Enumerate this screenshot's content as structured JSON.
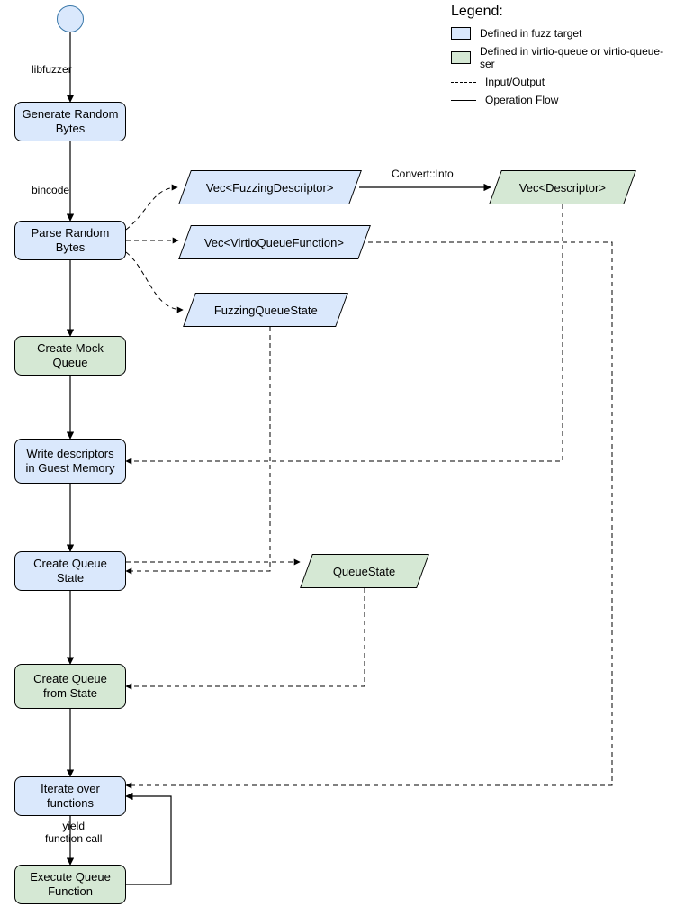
{
  "legend": {
    "title": "Legend:",
    "fuzz_target": "Defined in fuzz target",
    "virtio": "Defined in virtio-queue or virtio-queue-ser",
    "io": "Input/Output",
    "opflow": "Operation Flow"
  },
  "nodes": {
    "gen_bytes": "Generate Random Bytes",
    "parse_bytes": "Parse Random Bytes",
    "create_mock_queue": "Create Mock Queue",
    "write_desc": "Write descriptors in Guest Memory",
    "create_queue_state": "Create Queue State",
    "create_queue_from_state": "Create Queue from State",
    "iterate": "Iterate over functions",
    "exec": "Execute Queue Function"
  },
  "datatypes": {
    "vec_fuzz_desc": "Vec<FuzzingDescriptor>",
    "vec_virtio_fn": "Vec<VirtioQueueFunction>",
    "fuzz_q_state": "FuzzingQueueState",
    "vec_desc": "Vec<Descriptor>",
    "queue_state": "QueueState"
  },
  "labels": {
    "libfuzzer": "libfuzzer",
    "bincode": "bincode",
    "convert_into": "Convert::Into",
    "yield_fn": "yield\nfunction call"
  },
  "chart_data": {
    "type": "flowchart",
    "title": "",
    "start": "start-node",
    "legend": {
      "blue": "Defined in fuzz target",
      "green": "Defined in virtio-queue or virtio-queue-ser",
      "dashed_line": "Input/Output",
      "solid_line": "Operation Flow"
    },
    "nodes": [
      {
        "id": "start-node",
        "shape": "circle",
        "color": "blue",
        "label": ""
      },
      {
        "id": "gen-bytes",
        "shape": "rounded-rect",
        "color": "blue",
        "label": "Generate Random Bytes"
      },
      {
        "id": "parse-bytes",
        "shape": "rounded-rect",
        "color": "blue",
        "label": "Parse Random Bytes"
      },
      {
        "id": "create-mock-queue",
        "shape": "rounded-rect",
        "color": "green",
        "label": "Create Mock Queue"
      },
      {
        "id": "write-desc",
        "shape": "rounded-rect",
        "color": "blue",
        "label": "Write descriptors in Guest Memory"
      },
      {
        "id": "create-queue-state",
        "shape": "rounded-rect",
        "color": "blue",
        "label": "Create Queue State"
      },
      {
        "id": "create-queue-from-state",
        "shape": "rounded-rect",
        "color": "green",
        "label": "Create Queue from State"
      },
      {
        "id": "iterate",
        "shape": "rounded-rect",
        "color": "blue",
        "label": "Iterate over functions"
      },
      {
        "id": "exec",
        "shape": "rounded-rect",
        "color": "green",
        "label": "Execute Queue Function"
      },
      {
        "id": "vec-fuzz-desc",
        "shape": "parallelogram",
        "color": "blue",
        "label": "Vec<FuzzingDescriptor>"
      },
      {
        "id": "vec-virtio-fn",
        "shape": "parallelogram",
        "color": "blue",
        "label": "Vec<VirtioQueueFunction>"
      },
      {
        "id": "fuzz-q-state",
        "shape": "parallelogram",
        "color": "blue",
        "label": "FuzzingQueueState"
      },
      {
        "id": "vec-desc",
        "shape": "parallelogram",
        "color": "green",
        "label": "Vec<Descriptor>"
      },
      {
        "id": "queue-state",
        "shape": "parallelogram",
        "color": "green",
        "label": "QueueState"
      }
    ],
    "edges": [
      {
        "from": "start-node",
        "to": "gen-bytes",
        "style": "solid",
        "label": "libfuzzer"
      },
      {
        "from": "gen-bytes",
        "to": "parse-bytes",
        "style": "solid",
        "label": "bincode"
      },
      {
        "from": "parse-bytes",
        "to": "create-mock-queue",
        "style": "solid",
        "label": ""
      },
      {
        "from": "create-mock-queue",
        "to": "write-desc",
        "style": "solid",
        "label": ""
      },
      {
        "from": "write-desc",
        "to": "create-queue-state",
        "style": "solid",
        "label": ""
      },
      {
        "from": "create-queue-state",
        "to": "create-queue-from-state",
        "style": "solid",
        "label": ""
      },
      {
        "from": "create-queue-from-state",
        "to": "iterate",
        "style": "solid",
        "label": ""
      },
      {
        "from": "iterate",
        "to": "exec",
        "style": "solid",
        "label": "yield function call"
      },
      {
        "from": "exec",
        "to": "iterate",
        "style": "solid",
        "label": ""
      },
      {
        "from": "parse-bytes",
        "to": "vec-fuzz-desc",
        "style": "dashed",
        "label": ""
      },
      {
        "from": "parse-bytes",
        "to": "vec-virtio-fn",
        "style": "dashed",
        "label": ""
      },
      {
        "from": "parse-bytes",
        "to": "fuzz-q-state",
        "style": "dashed",
        "label": ""
      },
      {
        "from": "vec-fuzz-desc",
        "to": "vec-desc",
        "style": "solid",
        "label": "Convert::Into"
      },
      {
        "from": "vec-desc",
        "to": "write-desc",
        "style": "dashed",
        "label": ""
      },
      {
        "from": "fuzz-q-state",
        "to": "create-queue-state",
        "style": "dashed",
        "label": ""
      },
      {
        "from": "create-queue-state",
        "to": "queue-state",
        "style": "dashed",
        "label": ""
      },
      {
        "from": "queue-state",
        "to": "create-queue-from-state",
        "style": "dashed",
        "label": ""
      },
      {
        "from": "vec-virtio-fn",
        "to": "iterate",
        "style": "dashed",
        "label": ""
      }
    ]
  }
}
